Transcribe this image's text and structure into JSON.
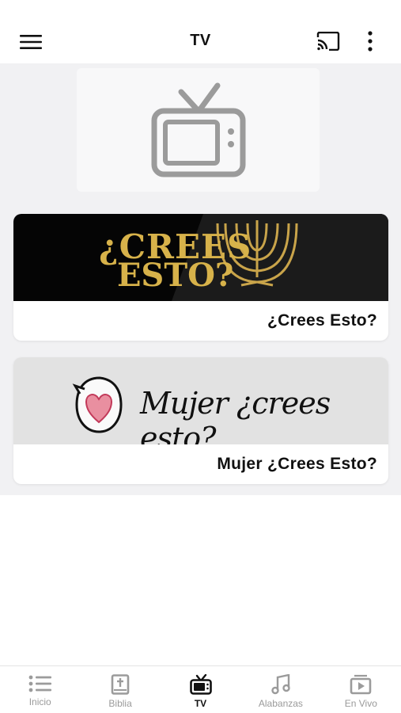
{
  "app_bar": {
    "title": "TV"
  },
  "cards": [
    {
      "logo_line1": "¿CREES",
      "logo_line2": "ESTO?",
      "caption": "¿Crees Esto?"
    },
    {
      "logo_script": "Mujer ¿crees esto?",
      "caption": "Mujer ¿Crees Esto?"
    }
  ],
  "bottom_nav": {
    "items": [
      {
        "label": "Inicio",
        "icon": "list-icon",
        "active": false
      },
      {
        "label": "Biblia",
        "icon": "bible-icon",
        "active": false
      },
      {
        "label": "TV",
        "icon": "tv-icon",
        "active": true
      },
      {
        "label": "Alabanzas",
        "icon": "music-note-icon",
        "active": false
      },
      {
        "label": "En Vivo",
        "icon": "live-play-icon",
        "active": false
      }
    ]
  },
  "colors": {
    "gold": "#d7b24a",
    "inactive": "#9a9a9a",
    "icon_gray": "#9b9b9b"
  }
}
